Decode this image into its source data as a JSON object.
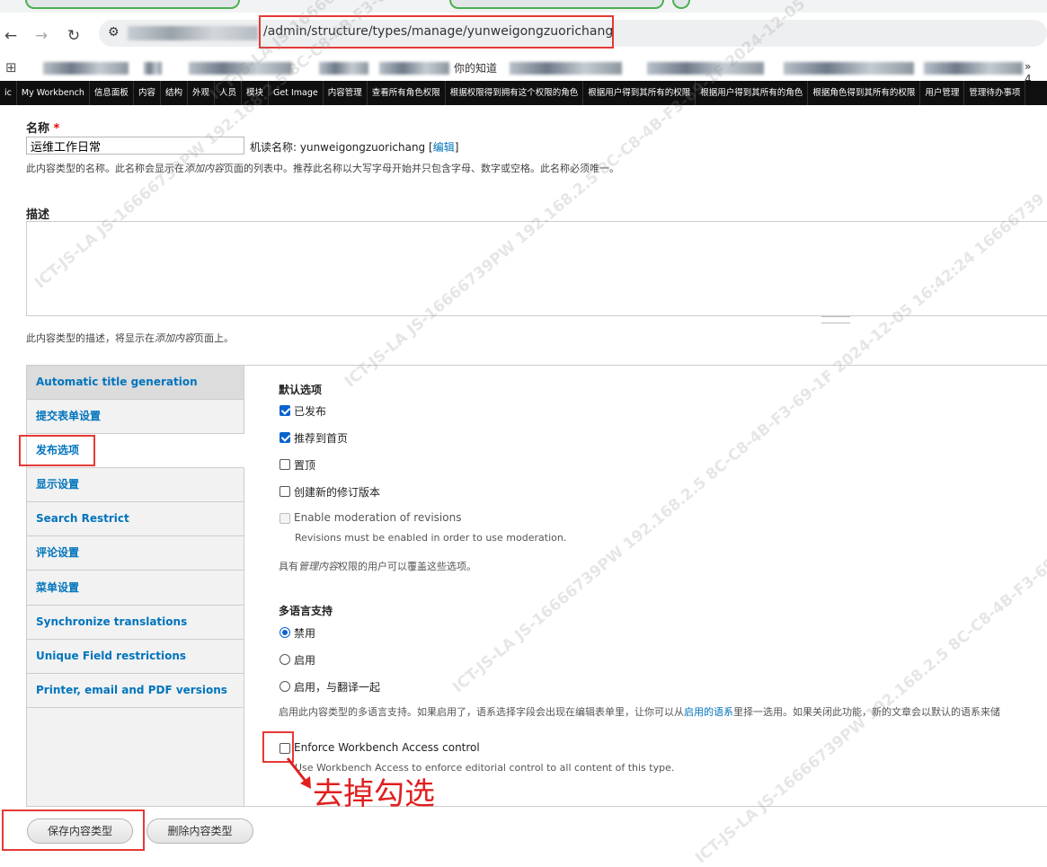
{
  "browser": {
    "url_path": "/admin/structure/types/manage/yunweigongzuorichang",
    "bookmark_text": "你的知道",
    "bookmark_end": "» 4..."
  },
  "admin_toolbar": {
    "items": [
      "ic",
      "My Workbench",
      "信息面板",
      "内容",
      "结构",
      "外观",
      "人员",
      "模块",
      "Get Image",
      "内容管理",
      "查看所有角色权限",
      "根据权限得到拥有这个权限的角色",
      "根据用户得到其所有的权限",
      "根据用户得到其所有的角色",
      "根据角色得到其所有的权限",
      "用户管理",
      "管理待办事项"
    ]
  },
  "form": {
    "name_label": "名称",
    "required_mark": "*",
    "name_value": "运维工作日常",
    "machine_name_prefix": "机读名称: yunweigongzuorichang [",
    "machine_name_edit": "编辑",
    "machine_name_suffix": "]",
    "name_help_1": "此内容类型的名称。此名称会显示在",
    "name_help_em": "添加内容",
    "name_help_2": "页面的列表中。推荐此名称以大写字母开始并只包含字母、数字或空格。此名称必须唯一。",
    "description_label": "描述",
    "description_help_1": "此内容类型的描述，将显示在",
    "description_help_em": "添加内容",
    "description_help_2": "页面上。"
  },
  "vertical_tabs": [
    "Automatic title generation",
    "提交表单设置",
    "发布选项",
    "显示设置",
    "Search Restrict",
    "评论设置",
    "菜单设置",
    "Synchronize translations",
    "Unique Field restrictions",
    "Printer, email and PDF versions"
  ],
  "publishing": {
    "default_options_title": "默认选项",
    "options": [
      {
        "label": "已发布",
        "checked": true
      },
      {
        "label": "推荐到首页",
        "checked": true
      },
      {
        "label": "置顶",
        "checked": false
      },
      {
        "label": "创建新的修订版本",
        "checked": false
      }
    ],
    "moderation_label": "Enable moderation of revisions",
    "moderation_help": "Revisions must be enabled in order to use moderation.",
    "override_help_1": "具有",
    "override_help_em": "管理内容",
    "override_help_2": "权限的用户可以覆盖这些选项。",
    "multilingual_title": "多语言支持",
    "multilingual_options": [
      {
        "label": "禁用",
        "checked": true
      },
      {
        "label": "启用",
        "checked": false
      },
      {
        "label": "启用，与翻译一起",
        "checked": false
      }
    ],
    "multilingual_help_1": "启用此内容类型的多语言支持。如果启用了，语系选择字段会出现在编辑表单里，让你可以从",
    "multilingual_help_link": "启用的语系",
    "multilingual_help_2": "里择一选用。如果关闭此功能，新的文章会以默认的语系来储",
    "enforce_label": "Enforce Workbench Access control",
    "enforce_help": "Use Workbench Access to enforce editorial control to all content of this type.",
    "enforce_checked": false
  },
  "annotation": "去掉勾选",
  "actions": {
    "save_label": "保存内容类型",
    "delete_label": "删除内容类型"
  },
  "watermark": "ICT-JS-LA JS-16666739PW 192.168.2.5 8C-C8-4B-F3-69-1F 2024-12-05 16:42:24 16666739",
  "colors": {
    "link": "#0074bd",
    "checkbox_checked": "#0b63ce",
    "highlight_red": "#e53935",
    "admin_bar_bg": "#0f0f0f"
  }
}
